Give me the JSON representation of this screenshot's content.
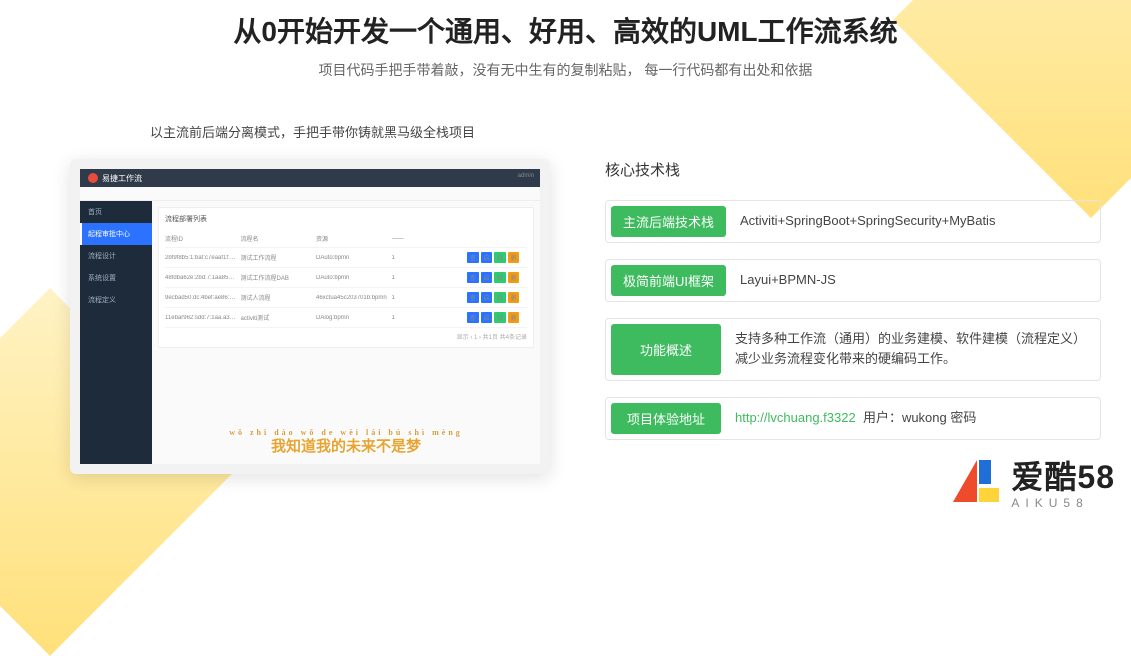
{
  "header": {
    "title": "从0开始开发一个通用、好用、高效的UML工作流系统",
    "subtitle": "项目代码手把手带着敲，没有无中生有的复制粘贴，  每一行代码都有出处和依据"
  },
  "intro": "以主流前后端分离模式，手把手带你铸就黑马级全栈项目",
  "stack": {
    "heading": "核心技术栈",
    "rows": [
      {
        "badge": "主流后端技术栈",
        "value": "Activiti+SpringBoot+SpringSecurity+MyBatis"
      },
      {
        "badge": "极简前端UI框架",
        "value": "Layui+BPMN-JS"
      },
      {
        "badge": "功能概述",
        "value": "支持多种工作流（通用）的业务建模、软件建模（流程定义）减少业务流程变化带来的硬编码工作。"
      },
      {
        "badge": "项目体验地址",
        "url": "http://lvchuang.f3322",
        "after": "用户：wukong   密码"
      }
    ]
  },
  "screenshot": {
    "app_name": "易捷工作流",
    "user": "admin",
    "sidebar": [
      "首页",
      "起程审批中心",
      "流程设计",
      "系统设置",
      "流程定义"
    ],
    "card_title": "流程部署列表",
    "table": {
      "cols": [
        "流程ID",
        "流程名",
        "资源",
        "——"
      ],
      "rows": [
        [
          "2bf9f8b5:1:baf:c7eaaf1f:1c5a8b",
          "测试工作流程",
          "DAuto:bpmn",
          "1"
        ],
        [
          "48fdba62e:2bd:7:1aa85b-a8b",
          "测试工作流程DAB",
          "DAuto:bpmn",
          "1"
        ],
        [
          "9ecbad50:dc:4bef:ae86:a8b",
          "测试人流程",
          "46xctua45c203701b:bpmn",
          "1"
        ],
        [
          "11ebar962:sdd:7:1aa.a3DD:a8b",
          "activiti测试",
          "DAlog:bpmn",
          "1"
        ]
      ],
      "footer": "显示  ‹ 1 ›  共1页 共4条记录"
    },
    "caption_pinyin": "wǒ zhī dào wǒ de wèi lái bú shì mèng",
    "caption": "我知道我的未来不是梦"
  },
  "watermark": {
    "cn": "爱酷58",
    "en": "AIKU58"
  }
}
